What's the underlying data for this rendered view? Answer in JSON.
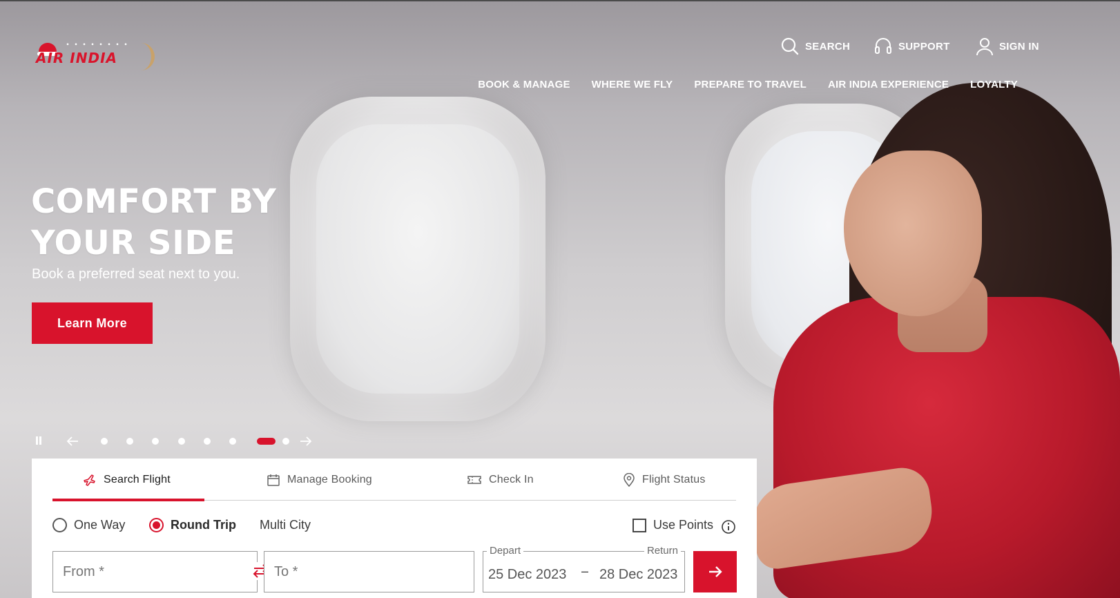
{
  "header": {
    "logo_text": "AIR INDIA",
    "search_label": "SEARCH",
    "support_label": "SUPPORT",
    "signin_label": "SIGN IN",
    "nav": [
      "BOOK & MANAGE",
      "WHERE WE FLY",
      "PREPARE TO TRAVEL",
      "AIR INDIA EXPERIENCE",
      "LOYALTY"
    ]
  },
  "hero": {
    "headline_line1": "COMFORT BY",
    "headline_line2": "YOUR SIDE",
    "subheadline": "Book a preferred seat next to you.",
    "cta_label": "Learn More",
    "slide_count": 8,
    "active_slide": 7
  },
  "booking": {
    "tabs": [
      {
        "label": "Search Flight",
        "icon": "plane-icon",
        "active": true
      },
      {
        "label": "Manage Booking",
        "icon": "calendar-icon",
        "active": false
      },
      {
        "label": "Check In",
        "icon": "ticket-icon",
        "active": false
      },
      {
        "label": "Flight Status",
        "icon": "location-pin-icon",
        "active": false
      }
    ],
    "trip_types": [
      {
        "label": "One Way",
        "selected": false
      },
      {
        "label": "Round Trip",
        "selected": true
      },
      {
        "label": "Multi City",
        "selected": false
      }
    ],
    "use_points_label": "Use Points",
    "use_points_checked": false,
    "from_placeholder": "From *",
    "to_placeholder": "To *",
    "depart_label": "Depart",
    "return_label": "Return",
    "depart_date": "25 Dec 2023",
    "return_date": "28 Dec 2023",
    "date_separator": "–"
  },
  "colors": {
    "brand_red": "#d8132c",
    "white": "#ffffff"
  }
}
